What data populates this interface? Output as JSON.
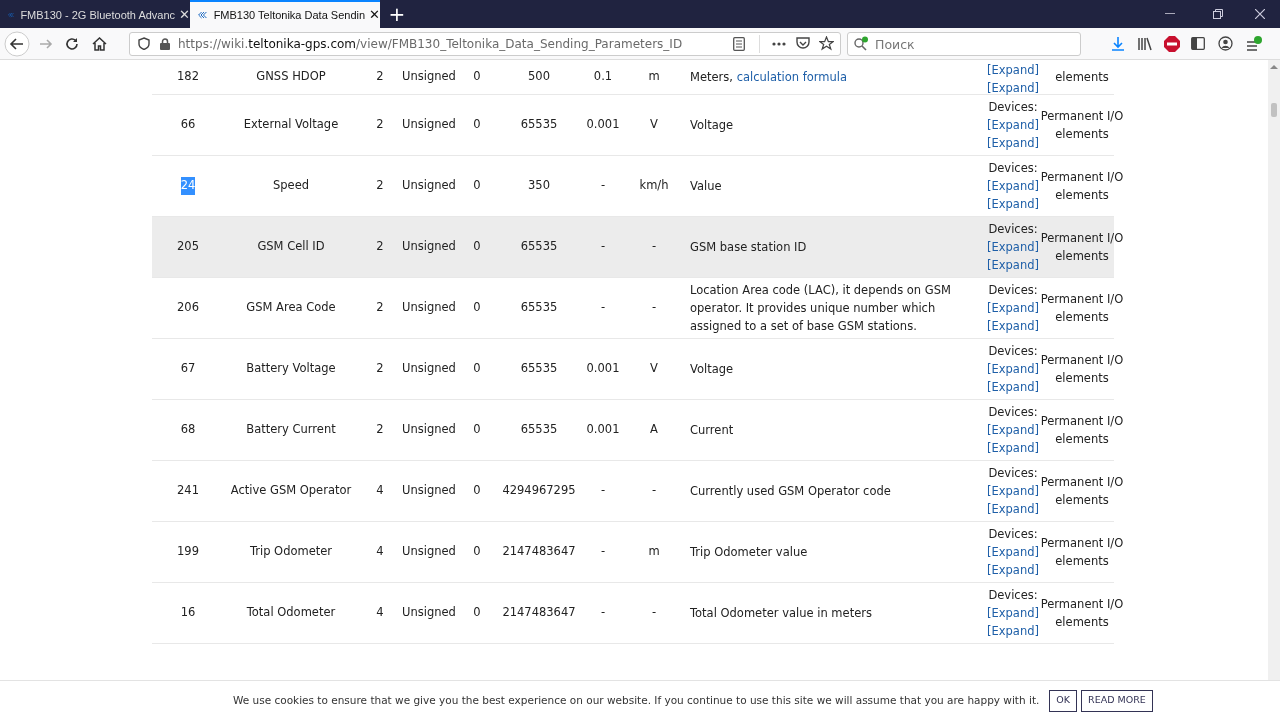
{
  "tabs": [
    {
      "title": "FMB130 - 2G Bluetooth Advanc",
      "selected": false,
      "close": "✕"
    },
    {
      "title": "FMB130 Teltonika Data Sendin",
      "selected": true,
      "close": "✕"
    }
  ],
  "new_tab": "+",
  "address": {
    "prefix": "https://wiki.",
    "domain": "teltonika-gps.com",
    "path": "/view/FMB130_Teltonika_Data_Sending_Parameters_ID"
  },
  "search": {
    "placeholder": "Поиск"
  },
  "rows": [
    {
      "id": "182",
      "name": "GNSS HDOP",
      "size": "2",
      "type": "Unsigned",
      "min": "0",
      "max": "500",
      "multiplier": "0.1",
      "units": "m",
      "description": "Meters,",
      "description_link": "calculation formula",
      "expand": [
        "[Expand]",
        "[Expand]"
      ],
      "group": "elements",
      "highlighted": false,
      "id_selected": false
    },
    {
      "id": "66",
      "name": "External Voltage",
      "size": "2",
      "type": "Unsigned",
      "min": "0",
      "max": "65535",
      "multiplier": "0.001",
      "units": "V",
      "description": "Voltage",
      "devices": "Devices:",
      "expand": [
        "[Expand]",
        "[Expand]"
      ],
      "group": "Permanent I/O elements",
      "highlighted": false,
      "id_selected": false
    },
    {
      "id": "24",
      "name": "Speed",
      "size": "2",
      "type": "Unsigned",
      "min": "0",
      "max": "350",
      "multiplier": "-",
      "units": "km/h",
      "description": "Value",
      "devices": "Devices:",
      "expand": [
        "[Expand]",
        "[Expand]"
      ],
      "group": "Permanent I/O elements",
      "highlighted": false,
      "id_selected": true
    },
    {
      "id": "205",
      "name": "GSM Cell ID",
      "size": "2",
      "type": "Unsigned",
      "min": "0",
      "max": "65535",
      "multiplier": "-",
      "units": "-",
      "description": "GSM base station ID",
      "devices": "Devices:",
      "expand": [
        "[Expand]",
        "[Expand]"
      ],
      "group": "Permanent I/O elements",
      "highlighted": true,
      "id_selected": false
    },
    {
      "id": "206",
      "name": "GSM Area Code",
      "size": "2",
      "type": "Unsigned",
      "min": "0",
      "max": "65535",
      "multiplier": "-",
      "units": "-",
      "description": "Location Area code (LAC), it depends on GSM operator. It provides unique number which assigned to a set of base GSM stations.",
      "devices": "Devices:",
      "expand": [
        "[Expand]",
        "[Expand]"
      ],
      "group": "Permanent I/O elements",
      "highlighted": false,
      "id_selected": false
    },
    {
      "id": "67",
      "name": "Battery Voltage",
      "size": "2",
      "type": "Unsigned",
      "min": "0",
      "max": "65535",
      "multiplier": "0.001",
      "units": "V",
      "description": "Voltage",
      "devices": "Devices:",
      "expand": [
        "[Expand]",
        "[Expand]"
      ],
      "group": "Permanent I/O elements",
      "highlighted": false,
      "id_selected": false
    },
    {
      "id": "68",
      "name": "Battery Current",
      "size": "2",
      "type": "Unsigned",
      "min": "0",
      "max": "65535",
      "multiplier": "0.001",
      "units": "A",
      "description": "Current",
      "devices": "Devices:",
      "expand": [
        "[Expand]",
        "[Expand]"
      ],
      "group": "Permanent I/O elements",
      "highlighted": false,
      "id_selected": false
    },
    {
      "id": "241",
      "name": "Active GSM Operator",
      "size": "4",
      "type": "Unsigned",
      "min": "0",
      "max": "4294967295",
      "multiplier": "-",
      "units": "-",
      "description": "Currently used GSM Operator code",
      "devices": "Devices:",
      "expand": [
        "[Expand]",
        "[Expand]"
      ],
      "group": "Permanent I/O elements",
      "highlighted": false,
      "id_selected": false
    },
    {
      "id": "199",
      "name": "Trip Odometer",
      "size": "4",
      "type": "Unsigned",
      "min": "0",
      "max": "2147483647",
      "multiplier": "-",
      "units": "m",
      "description": "Trip Odometer value",
      "devices": "Devices:",
      "expand": [
        "[Expand]",
        "[Expand]"
      ],
      "group": "Permanent I/O elements",
      "highlighted": false,
      "id_selected": false
    },
    {
      "id": "16",
      "name": "Total Odometer",
      "size": "4",
      "type": "Unsigned",
      "min": "0",
      "max": "2147483647",
      "multiplier": "-",
      "units": "-",
      "description": "Total Odometer value in meters",
      "devices": "Devices:",
      "expand": [
        "[Expand]",
        "[Expand]"
      ],
      "group": "Permanent I/O elements",
      "highlighted": false,
      "id_selected": false
    }
  ],
  "cookie_bar": {
    "text": "We use cookies to ensure that we give you the best experience on our website. If you continue to use this site we will assume that you are happy with it.",
    "buttons": [
      "OK",
      "READ MORE"
    ]
  }
}
